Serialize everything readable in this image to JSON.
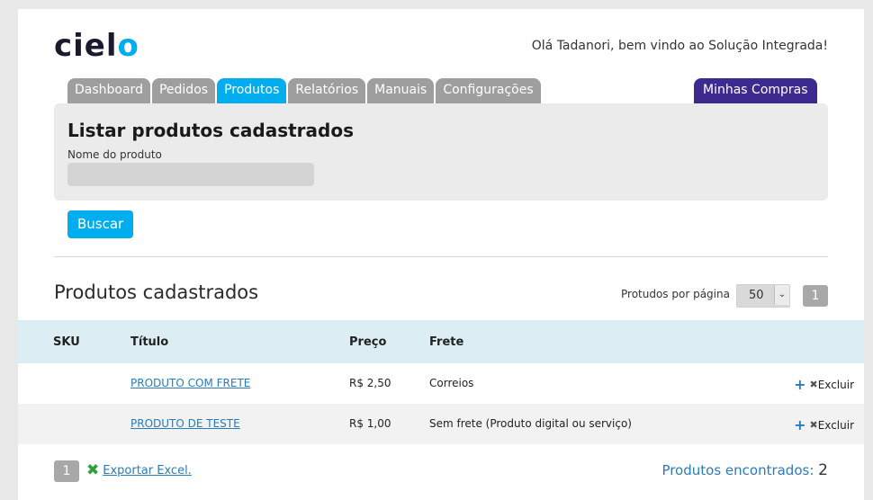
{
  "brand": {
    "logo_text_main": "ciel",
    "logo_text_accent": "o"
  },
  "header": {
    "greeting": "Olá Tadanori, bem vindo ao Solução Integrada!"
  },
  "tabs": [
    {
      "label": "Dashboard",
      "active": false
    },
    {
      "label": "Pedidos",
      "active": false
    },
    {
      "label": "Produtos",
      "active": true
    },
    {
      "label": "Relatórios",
      "active": false
    },
    {
      "label": "Manuais",
      "active": false
    },
    {
      "label": "Configurações",
      "active": false
    }
  ],
  "purchases_tab": {
    "label": "Minhas Compras"
  },
  "search": {
    "title": "Listar produtos cadastrados",
    "field_label": "Nome do produto",
    "field_value": "",
    "button": "Buscar"
  },
  "list": {
    "title": "Produtos cadastrados",
    "per_page_label": "Protudos por página",
    "per_page_value": "50",
    "page_current": "1"
  },
  "table": {
    "headers": {
      "sku": "SKU",
      "title": "Título",
      "price": "Preço",
      "shipping": "Frete"
    },
    "rows": [
      {
        "sku": "",
        "title": "PRODUTO COM FRETE",
        "price": "R$ 2,50",
        "shipping": "Correios",
        "action": "Excluir"
      },
      {
        "sku": "",
        "title": "PRODUTO DE TESTE",
        "price": "R$ 1,00",
        "shipping": "Sem frete (Produto digital ou serviço)",
        "action": "Excluir"
      }
    ]
  },
  "footer": {
    "page_current": "1",
    "export_label": "Exportar Excel.",
    "found_label": "Produtos encontrados:",
    "found_count": "2"
  },
  "colors": {
    "accent": "#00aeef",
    "purple": "#3d2a8f",
    "link": "#2b7bb9"
  }
}
